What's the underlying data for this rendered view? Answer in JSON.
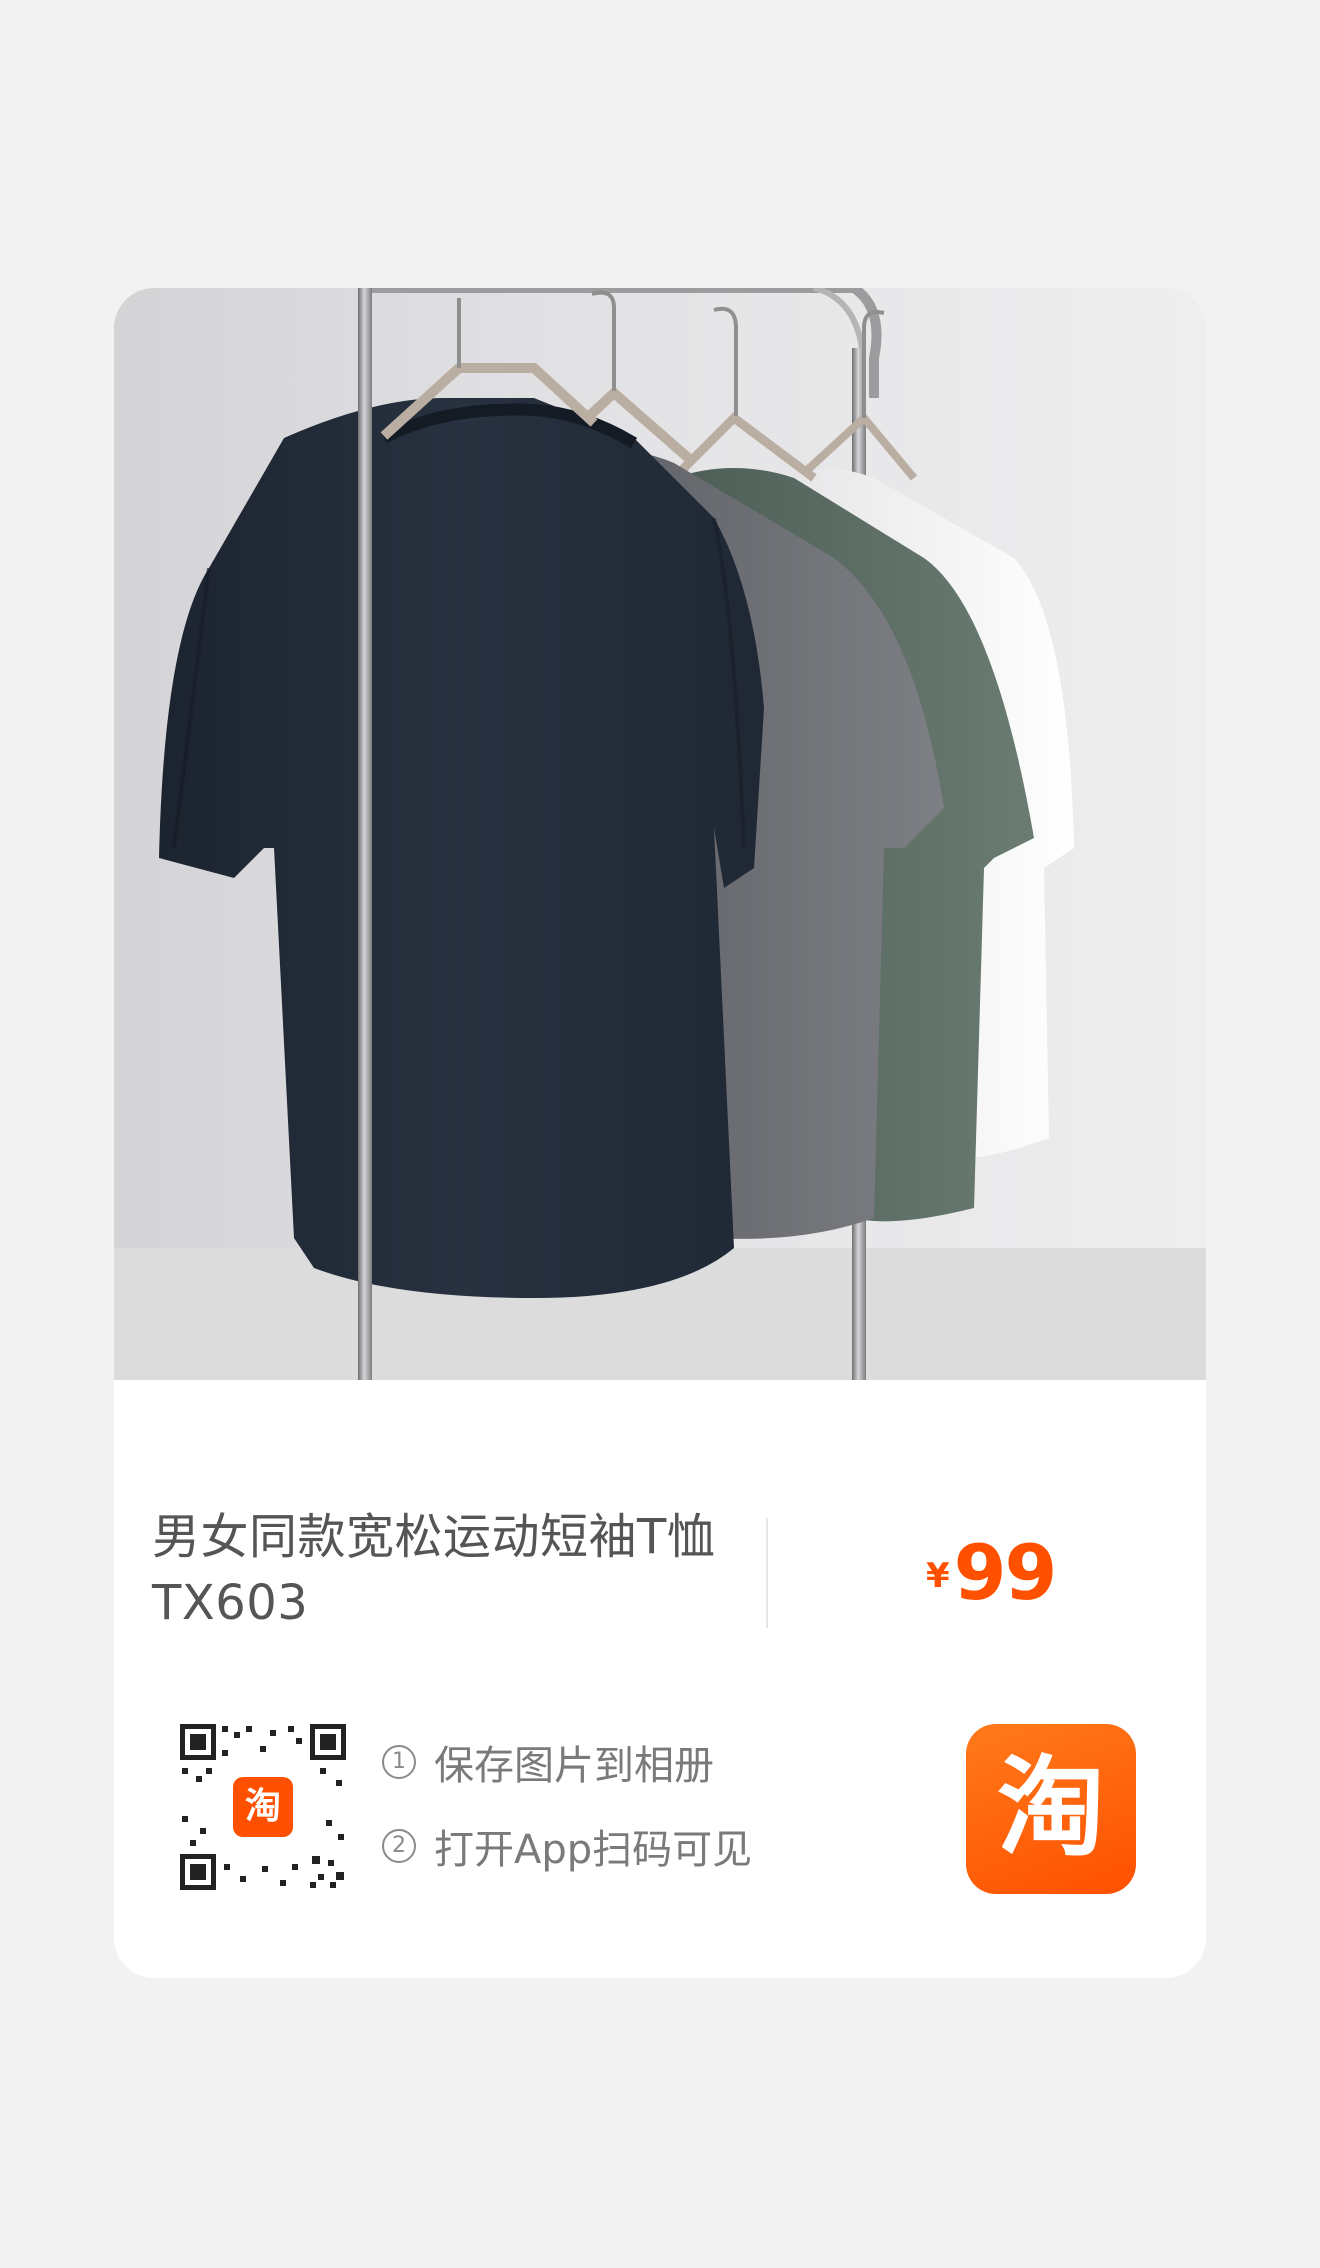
{
  "product": {
    "title_line1": "男女同款宽松运动短袖T恤",
    "title_line2": "TX603",
    "currency_symbol": "¥",
    "price": "99"
  },
  "share": {
    "step1_number": "①",
    "step1_text": "保存图片到相册",
    "step2_number": "②",
    "step2_text": "打开App扫码可见"
  },
  "qr": {
    "center_badge": "淘"
  },
  "app": {
    "icon_glyph": "淘",
    "icon_name": "taobao-app-icon"
  },
  "colors": {
    "background": "#f2f2f2",
    "card": "#ffffff",
    "brand_orange": "#ff5000",
    "title_text": "#555555",
    "secondary_text": "#7a7a7a"
  }
}
